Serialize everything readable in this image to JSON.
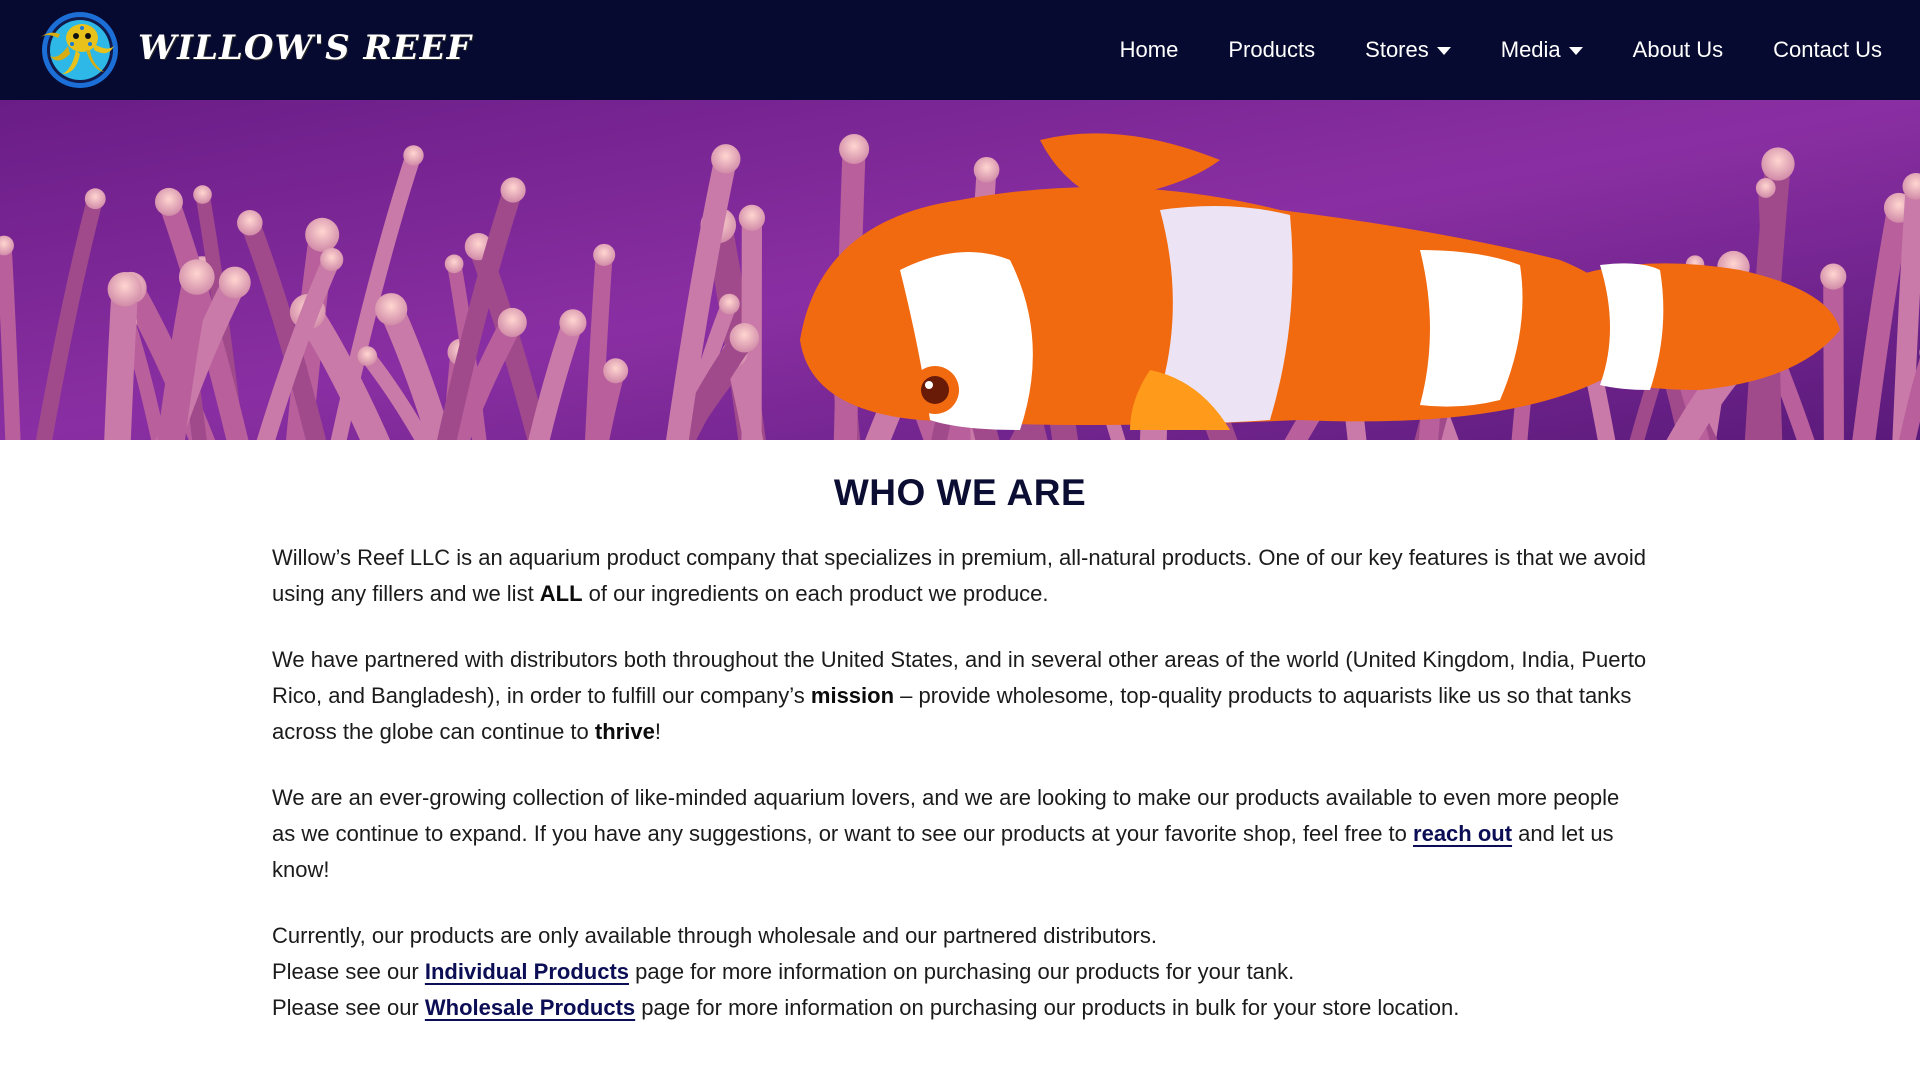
{
  "brand": {
    "name": "WILLOW'S REEF",
    "logo_icon": "octopus-logo-icon"
  },
  "nav": {
    "items": [
      {
        "label": "Home",
        "dropdown": false
      },
      {
        "label": "Products",
        "dropdown": false
      },
      {
        "label": "Stores",
        "dropdown": true
      },
      {
        "label": "Media",
        "dropdown": true
      },
      {
        "label": "About Us",
        "dropdown": false
      },
      {
        "label": "Contact Us",
        "dropdown": false
      }
    ]
  },
  "hero": {
    "subject": "clownfish-anemone-banner"
  },
  "main": {
    "heading": "WHO WE ARE",
    "p1": {
      "a": "Willow’s Reef LLC is an aquarium product company that specializes in premium, all-natural products. One of our key features is that we avoid using any fillers and we list ",
      "b": "ALL",
      "c": " of our ingredients on each product we produce."
    },
    "p2": {
      "a": "We have partnered with distributors both throughout the United States, and in several other areas of the world (United Kingdom, India, Puerto Rico, and Bangladesh), in order to fulfill our company’s ",
      "b": "mission",
      "c": " – provide wholesome, top-quality products to aquarists like us so that tanks across the globe can continue to ",
      "d": "thrive",
      "e": "!"
    },
    "p3": {
      "a": "We are an ever-growing collection of like-minded aquarium lovers, and we are looking to make our products available to even more people as we continue to expand. If you have any suggestions, or want to see our products at your favorite shop, feel free to ",
      "link": "reach out",
      "b": " and let us know!"
    },
    "p4": {
      "line1": "Currently, our products are only available through wholesale and our partnered distributors.",
      "line2_a": "Please see our ",
      "line2_link": "Individual Products",
      "line2_b": " page for more information on purchasing our products for your tank.",
      "line3_a": "Please see our ",
      "line3_link": "Wholesale Products",
      "line3_b": " page for more information on purchasing our products in bulk for your store location."
    }
  },
  "colors": {
    "nav_bg": "#070a30",
    "heading": "#0b0d33",
    "link": "#0b0d55",
    "accent_orange": "#f26a10"
  }
}
